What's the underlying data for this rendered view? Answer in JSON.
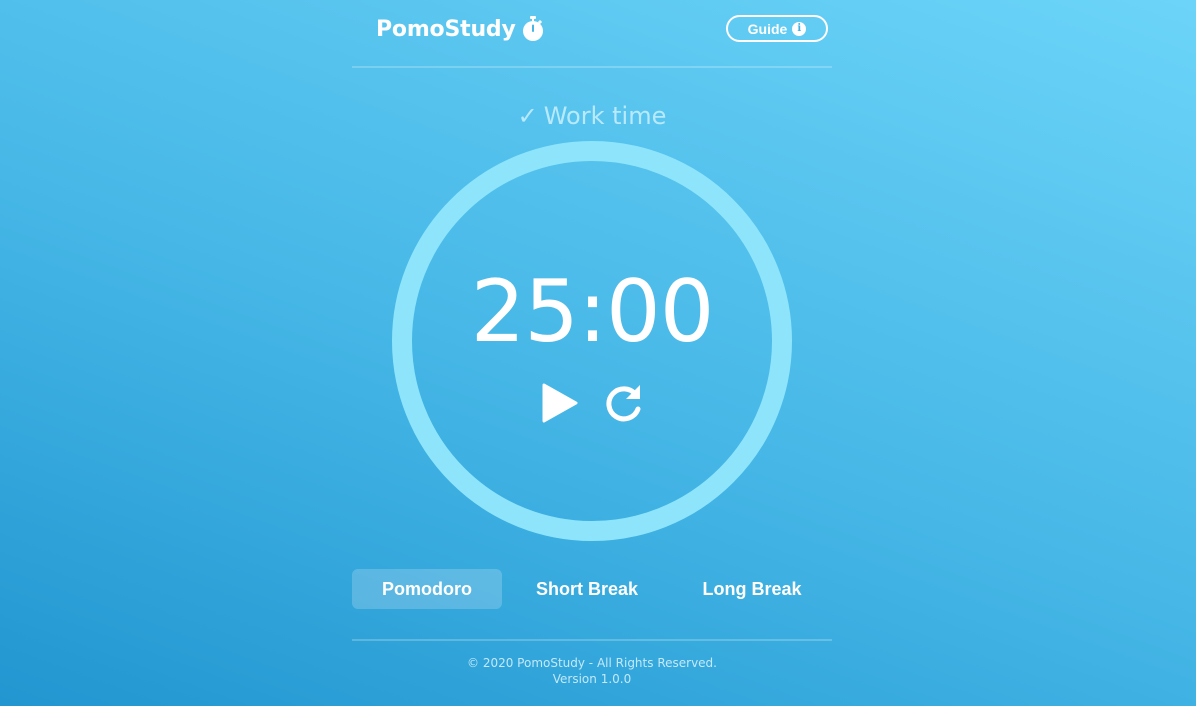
{
  "header": {
    "app_name": "PomoStudy",
    "guide_label": "Guide",
    "info_symbol": "i",
    "icons": {
      "logo": "stopwatch-icon",
      "guide": "info-icon"
    }
  },
  "timer": {
    "mode_check": "✓",
    "mode_label": "Work time",
    "time": "25:00",
    "controls": {
      "play": "play-icon",
      "reset": "reset-icon"
    },
    "ring_color": "#8ee5fb"
  },
  "tabs": [
    {
      "label": "Pomodoro",
      "active": true
    },
    {
      "label": "Short Break",
      "active": false
    },
    {
      "label": "Long Break",
      "active": false
    }
  ],
  "footer": {
    "copyright": "© 2020 PomoStudy - All Rights Reserved.",
    "version": "Version 1.0.0"
  },
  "colors": {
    "bg_start": "#2196d0",
    "bg_end": "#6cd4f8",
    "text": "#ffffff"
  }
}
